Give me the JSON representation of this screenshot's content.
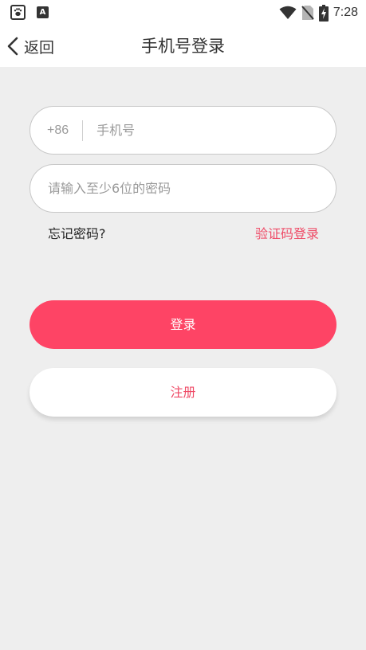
{
  "status_bar": {
    "app1_icon": "baidu-paw-icon",
    "app2_icon": "a-letter-icon",
    "app2_letter": "A",
    "wifi_icon": "wifi-icon",
    "sim_icon": "no-sim-icon",
    "battery_icon": "battery-charging-icon",
    "time": "7:28"
  },
  "nav": {
    "back_label": "返回",
    "title": "手机号登录"
  },
  "form": {
    "country_code": "+86",
    "phone_placeholder": "手机号",
    "phone_value": "",
    "password_placeholder": "请输入至少6位的密码",
    "password_value": "",
    "forgot_label": "忘记密码?",
    "code_login_label": "验证码登录"
  },
  "buttons": {
    "login_label": "登录",
    "register_label": "注册"
  },
  "colors": {
    "accent": "#fe4465",
    "link_accent": "#ef4a66",
    "background": "#eeeeee"
  }
}
